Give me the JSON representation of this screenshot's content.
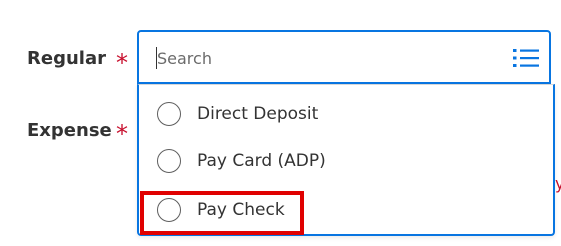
{
  "form": {
    "fields": [
      {
        "label": "Regular",
        "required_mark": "*"
      },
      {
        "label": "Expense",
        "required_mark": "*"
      }
    ]
  },
  "search": {
    "placeholder": "Search",
    "value": "",
    "icon": "list-icon"
  },
  "dropdown": {
    "options": [
      {
        "label": "Direct Deposit",
        "selected": false
      },
      {
        "label": "Pay Card (ADP)",
        "selected": false
      },
      {
        "label": "Pay Check",
        "selected": false
      }
    ]
  },
  "annotation": {
    "highlighted_option": "Pay Check",
    "color": "#e00000"
  },
  "colors": {
    "focus_border": "#0875e1",
    "required": "#c8102e",
    "text": "#333333"
  }
}
